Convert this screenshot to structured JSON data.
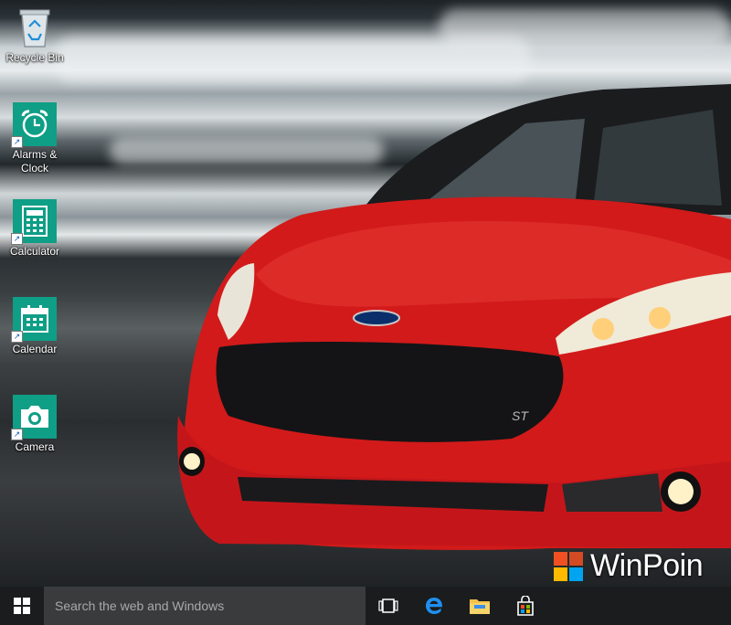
{
  "desktop": {
    "icons": [
      {
        "label": "Recycle Bin",
        "icon": "recycle-bin-icon"
      },
      {
        "label": "Alarms &\nClock",
        "icon": "alarm-clock-icon"
      },
      {
        "label": "Calculator",
        "icon": "calculator-icon"
      },
      {
        "label": "Calendar",
        "icon": "calendar-icon"
      },
      {
        "label": "Camera",
        "icon": "camera-icon"
      }
    ],
    "tile_color": "#0f9e86"
  },
  "watermark": {
    "text": "WinPoin",
    "logo_colors": [
      "#f25022",
      "#f25022",
      "#ffb900",
      "#00a4ef"
    ]
  },
  "taskbar": {
    "search_placeholder": "Search the web and Windows",
    "buttons": [
      "start-icon",
      "task-view-icon",
      "edge-icon",
      "file-explorer-icon",
      "store-icon"
    ]
  },
  "wallpaper": {
    "badge": "ST"
  }
}
